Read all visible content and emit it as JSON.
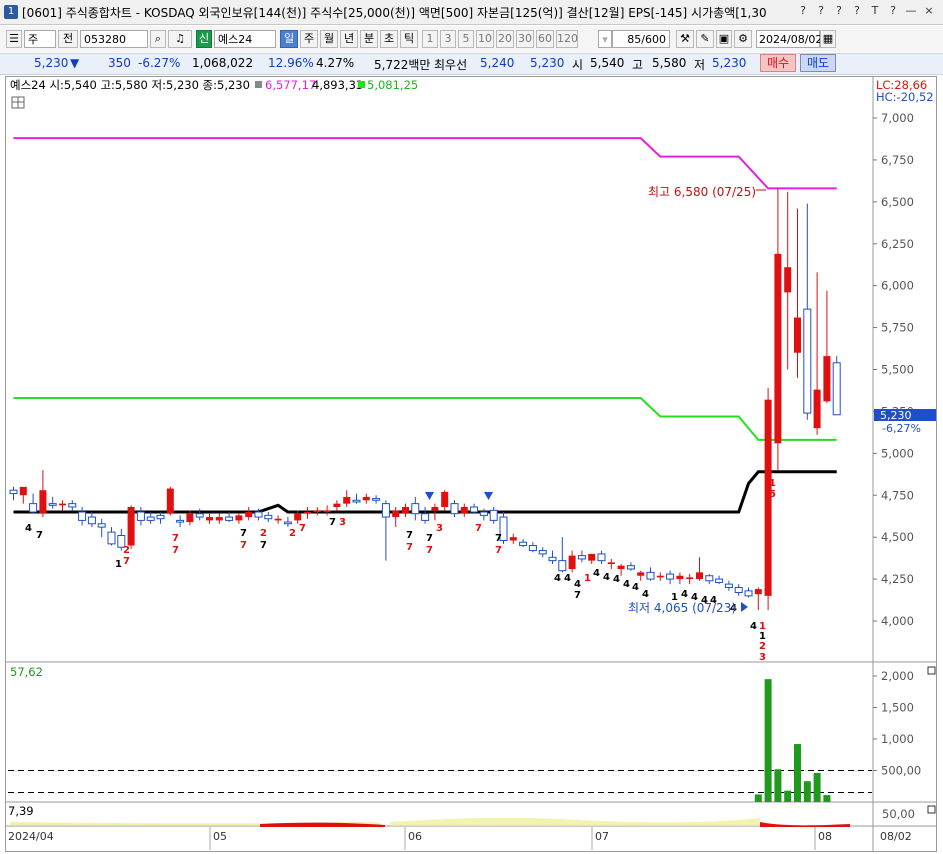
{
  "window": {
    "badge": "1",
    "title": "[0601] 주식종합차트 - KOSDAQ 외국인보유[144(천)] 주식수[25,000(천)] 액면[500] 자본금[125(억)] 결산[12월] EPS[-145] 시가총액[1,30",
    "controls": [
      "?",
      "?",
      "?",
      "?",
      "T",
      "?",
      "?",
      "—",
      "□",
      "×"
    ]
  },
  "toolbar": {
    "period_type": "주",
    "prev_label": "전",
    "code": "053280",
    "credit_label": "신",
    "stock_name": "예스24",
    "periods": [
      "일",
      "주",
      "월",
      "년",
      "분",
      "초",
      "틱"
    ],
    "selected_period": "일",
    "intervals": [
      "1",
      "3",
      "5",
      "10",
      "20",
      "30",
      "60",
      "120"
    ],
    "count": "85/600",
    "date": "2024/08/02"
  },
  "quote": {
    "price": "5,230",
    "change_arrow": "▼",
    "change": "350",
    "change_rate": "-6.27%",
    "volume": "1,068,022",
    "turnover_rate": "12.96%",
    "extra_rate": "4.27%",
    "amount": "5,722백만",
    "priority_label": "최우선",
    "ask": "5,240",
    "bid": "5,230",
    "open_label": "시",
    "open": "5,540",
    "high_label": "고",
    "high": "5,580",
    "low_label": "저",
    "low": "5,230",
    "buy_button": "매수",
    "sell_button": "매도"
  },
  "chart_header": {
    "ohlc_text": "예스24 시:5,540 고:5,580 저:5,230 종:5,230",
    "line1_value": "6,577,17",
    "line2_value": "4,893,33",
    "line3_value": "5,081,25",
    "lc": "LC:28,66",
    "hc": "HC:-20,52",
    "current_price": "5,230",
    "current_change": "-6,27%",
    "high_annot": "최고 6,580 (07/25)",
    "low_annot": "최저 4,065 (07/23)"
  },
  "volume_header": {
    "value": "57,62"
  },
  "osc_header": {
    "value": "7,39"
  },
  "date_axis": [
    "2024/04",
    "05",
    "06",
    "07",
    "08",
    "08/02"
  ],
  "colors": {
    "up": "#e01010",
    "down": "#1e4fc8",
    "magenta": "#e61ee6",
    "green": "#22e022",
    "black": "#000000",
    "vol": "#1e9a1e"
  },
  "chart_data": [
    {
      "type": "candlestick",
      "title": "예스24",
      "y_ticks": [
        "7,000",
        "6,750",
        "6,500",
        "6,250",
        "6,000",
        "5,750",
        "5,500",
        "5,250",
        "5,000",
        "4,750",
        "4,500",
        "4,250",
        "4,000"
      ],
      "ylim": [
        3830,
        7080
      ],
      "candles": [
        {
          "o": 4780,
          "h": 4800,
          "l": 4720,
          "c": 4760
        },
        {
          "o": 4750,
          "h": 4790,
          "l": 4700,
          "c": 4800
        },
        {
          "o": 4700,
          "h": 4760,
          "l": 4640,
          "c": 4650
        },
        {
          "o": 4640,
          "h": 4900,
          "l": 4620,
          "c": 4780
        },
        {
          "o": 4700,
          "h": 4740,
          "l": 4670,
          "c": 4690
        },
        {
          "o": 4690,
          "h": 4720,
          "l": 4660,
          "c": 4700
        },
        {
          "o": 4700,
          "h": 4720,
          "l": 4660,
          "c": 4680
        },
        {
          "o": 4650,
          "h": 4680,
          "l": 4570,
          "c": 4600
        },
        {
          "o": 4620,
          "h": 4650,
          "l": 4560,
          "c": 4580
        },
        {
          "o": 4580,
          "h": 4610,
          "l": 4500,
          "c": 4560
        },
        {
          "o": 4530,
          "h": 4560,
          "l": 4450,
          "c": 4460
        },
        {
          "o": 4510,
          "h": 4550,
          "l": 4420,
          "c": 4440
        },
        {
          "o": 4450,
          "h": 4690,
          "l": 4430,
          "c": 4680
        },
        {
          "o": 4650,
          "h": 4680,
          "l": 4570,
          "c": 4600
        },
        {
          "o": 4620,
          "h": 4650,
          "l": 4580,
          "c": 4600
        },
        {
          "o": 4630,
          "h": 4650,
          "l": 4580,
          "c": 4610
        },
        {
          "o": 4640,
          "h": 4800,
          "l": 4630,
          "c": 4790
        },
        {
          "o": 4600,
          "h": 4630,
          "l": 4560,
          "c": 4590
        },
        {
          "o": 4590,
          "h": 4660,
          "l": 4570,
          "c": 4640
        },
        {
          "o": 4640,
          "h": 4670,
          "l": 4600,
          "c": 4620
        },
        {
          "o": 4600,
          "h": 4640,
          "l": 4580,
          "c": 4620
        },
        {
          "o": 4600,
          "h": 4640,
          "l": 4580,
          "c": 4620
        },
        {
          "o": 4620,
          "h": 4650,
          "l": 4590,
          "c": 4600
        },
        {
          "o": 4600,
          "h": 4640,
          "l": 4580,
          "c": 4630
        },
        {
          "o": 4620,
          "h": 4680,
          "l": 4600,
          "c": 4650
        },
        {
          "o": 4650,
          "h": 4670,
          "l": 4600,
          "c": 4620
        },
        {
          "o": 4630,
          "h": 4650,
          "l": 4590,
          "c": 4610
        },
        {
          "o": 4600,
          "h": 4630,
          "l": 4580,
          "c": 4610
        },
        {
          "o": 4590,
          "h": 4620,
          "l": 4560,
          "c": 4580
        },
        {
          "o": 4600,
          "h": 4660,
          "l": 4580,
          "c": 4640
        },
        {
          "o": 4640,
          "h": 4680,
          "l": 4610,
          "c": 4650
        },
        {
          "o": 4650,
          "h": 4680,
          "l": 4630,
          "c": 4660
        },
        {
          "o": 4650,
          "h": 4690,
          "l": 4630,
          "c": 4660
        },
        {
          "o": 4680,
          "h": 4720,
          "l": 4660,
          "c": 4700
        },
        {
          "o": 4700,
          "h": 4780,
          "l": 4680,
          "c": 4740
        },
        {
          "o": 4720,
          "h": 4760,
          "l": 4700,
          "c": 4710
        },
        {
          "o": 4720,
          "h": 4760,
          "l": 4700,
          "c": 4740
        },
        {
          "o": 4730,
          "h": 4750,
          "l": 4700,
          "c": 4720
        },
        {
          "o": 4700,
          "h": 4720,
          "l": 4360,
          "c": 4620
        },
        {
          "o": 4620,
          "h": 4680,
          "l": 4560,
          "c": 4660
        },
        {
          "o": 4640,
          "h": 4700,
          "l": 4620,
          "c": 4680
        },
        {
          "o": 4700,
          "h": 4740,
          "l": 4600,
          "c": 4640
        },
        {
          "o": 4640,
          "h": 4680,
          "l": 4580,
          "c": 4600
        },
        {
          "o": 4660,
          "h": 4700,
          "l": 4600,
          "c": 4680
        },
        {
          "o": 4680,
          "h": 4780,
          "l": 4660,
          "c": 4770
        },
        {
          "o": 4700,
          "h": 4720,
          "l": 4620,
          "c": 4640
        },
        {
          "o": 4640,
          "h": 4700,
          "l": 4620,
          "c": 4680
        },
        {
          "o": 4680,
          "h": 4700,
          "l": 4640,
          "c": 4650
        },
        {
          "o": 4650,
          "h": 4670,
          "l": 4600,
          "c": 4630
        },
        {
          "o": 4660,
          "h": 4680,
          "l": 4580,
          "c": 4600
        },
        {
          "o": 4620,
          "h": 4650,
          "l": 4460,
          "c": 4480
        },
        {
          "o": 4480,
          "h": 4520,
          "l": 4460,
          "c": 4500
        },
        {
          "o": 4470,
          "h": 4490,
          "l": 4440,
          "c": 4450
        },
        {
          "o": 4450,
          "h": 4470,
          "l": 4410,
          "c": 4420
        },
        {
          "o": 4420,
          "h": 4440,
          "l": 4380,
          "c": 4400
        },
        {
          "o": 4380,
          "h": 4420,
          "l": 4340,
          "c": 4360
        },
        {
          "o": 4360,
          "h": 4500,
          "l": 4290,
          "c": 4300
        },
        {
          "o": 4310,
          "h": 4420,
          "l": 4290,
          "c": 4390
        },
        {
          "o": 4390,
          "h": 4420,
          "l": 4350,
          "c": 4370
        },
        {
          "o": 4360,
          "h": 4400,
          "l": 4340,
          "c": 4400
        },
        {
          "o": 4400,
          "h": 4420,
          "l": 4340,
          "c": 4360
        },
        {
          "o": 4340,
          "h": 4370,
          "l": 4310,
          "c": 4350
        },
        {
          "o": 4310,
          "h": 4340,
          "l": 4270,
          "c": 4330
        },
        {
          "o": 4330,
          "h": 4350,
          "l": 4300,
          "c": 4310
        },
        {
          "o": 4270,
          "h": 4300,
          "l": 4240,
          "c": 4290
        },
        {
          "o": 4290,
          "h": 4320,
          "l": 4240,
          "c": 4250
        },
        {
          "o": 4260,
          "h": 4290,
          "l": 4240,
          "c": 4270
        },
        {
          "o": 4280,
          "h": 4300,
          "l": 4220,
          "c": 4250
        },
        {
          "o": 4250,
          "h": 4290,
          "l": 4220,
          "c": 4270
        },
        {
          "o": 4250,
          "h": 4280,
          "l": 4220,
          "c": 4260
        },
        {
          "o": 4250,
          "h": 4380,
          "l": 4240,
          "c": 4290
        },
        {
          "o": 4270,
          "h": 4280,
          "l": 4220,
          "c": 4240
        },
        {
          "o": 4250,
          "h": 4270,
          "l": 4220,
          "c": 4230
        },
        {
          "o": 4220,
          "h": 4240,
          "l": 4180,
          "c": 4200
        },
        {
          "o": 4200,
          "h": 4220,
          "l": 4150,
          "c": 4170
        },
        {
          "o": 4180,
          "h": 4200,
          "l": 4140,
          "c": 4150
        },
        {
          "o": 4160,
          "h": 4200,
          "l": 4065,
          "c": 4190
        },
        {
          "o": 4150,
          "h": 5390,
          "l": 4065,
          "c": 5320
        },
        {
          "o": 5060,
          "h": 6580,
          "l": 4900,
          "c": 6190
        },
        {
          "o": 5960,
          "h": 6560,
          "l": 5500,
          "c": 6110
        },
        {
          "o": 5600,
          "h": 6460,
          "l": 5450,
          "c": 5810
        },
        {
          "o": 5860,
          "h": 6490,
          "l": 5200,
          "c": 5240
        },
        {
          "o": 5150,
          "h": 6080,
          "l": 5110,
          "c": 5380
        },
        {
          "o": 5310,
          "h": 5970,
          "l": 5300,
          "c": 5580
        },
        {
          "o": 5540,
          "h": 5580,
          "l": 5230,
          "c": 5230
        }
      ],
      "lines": {
        "magenta": [
          [
            0,
            6880
          ],
          [
            64,
            6880
          ],
          [
            66,
            6770
          ],
          [
            74,
            6770
          ],
          [
            77,
            6580
          ],
          [
            84,
            6580
          ]
        ],
        "green": [
          [
            0,
            5330
          ],
          [
            64,
            5330
          ],
          [
            66,
            5220
          ],
          [
            74,
            5220
          ],
          [
            76,
            5080
          ],
          [
            84,
            5080
          ]
        ],
        "black": [
          [
            0,
            4650
          ],
          [
            25,
            4650
          ],
          [
            27,
            4690
          ],
          [
            28,
            4650
          ],
          [
            74,
            4650
          ],
          [
            75,
            4820
          ],
          [
            76,
            4890
          ],
          [
            84,
            4890
          ]
        ]
      }
    },
    {
      "type": "bar",
      "title": "volume",
      "y_ticks": [
        "2,000",
        "1,500",
        "1,000",
        "500,00"
      ],
      "ylim": [
        0,
        2100
      ],
      "values": [
        [
          76,
          120
        ],
        [
          77,
          1950
        ],
        [
          78,
          520
        ],
        [
          79,
          180
        ],
        [
          80,
          920
        ],
        [
          81,
          330
        ],
        [
          82,
          460
        ],
        [
          83,
          110
        ]
      ],
      "dashed_levels": [
        500,
        150
      ]
    },
    {
      "type": "area",
      "title": "oscillator",
      "y_ticks": [
        "50,00"
      ]
    }
  ]
}
